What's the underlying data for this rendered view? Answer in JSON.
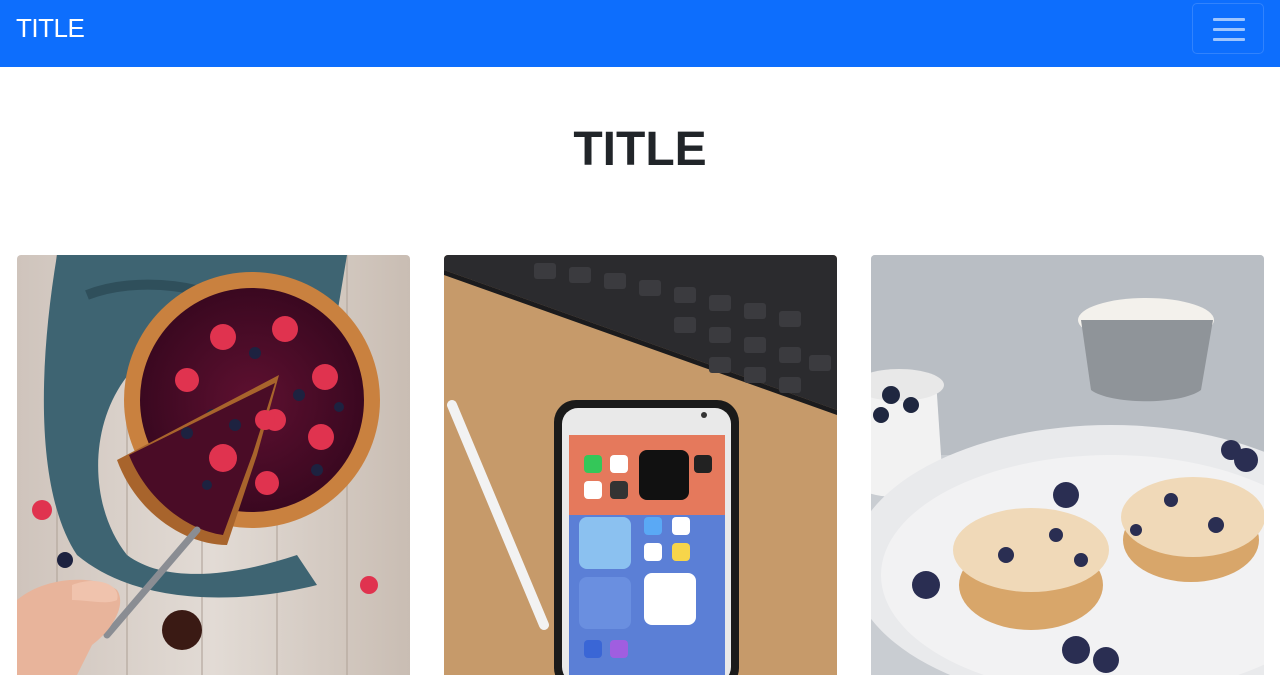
{
  "navbar": {
    "brand": "TITLE",
    "toggler_icon": "hamburger-menu-icon",
    "background": "#0d6efd"
  },
  "main": {
    "title": "TITLE"
  },
  "cards": [
    {
      "image": "berry-tart-photo"
    },
    {
      "image": "smartphone-keyboard-photo"
    },
    {
      "image": "blueberry-muffins-photo"
    }
  ]
}
